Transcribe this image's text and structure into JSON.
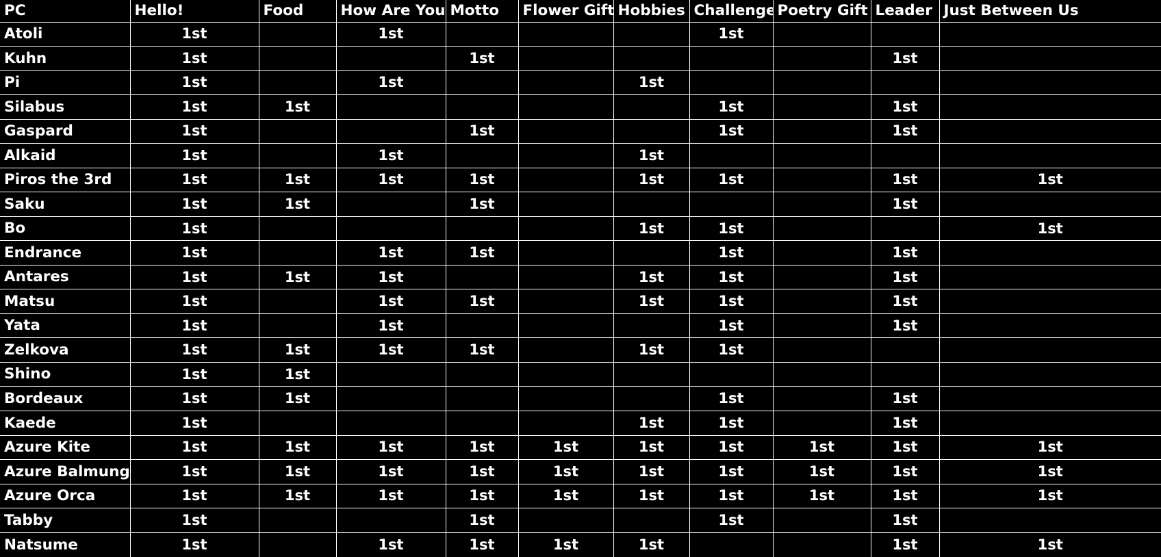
{
  "table": {
    "mark": "1st",
    "empty": "",
    "columns": [
      "PC",
      "Hello!",
      "Food",
      "How Are You?",
      "Motto",
      "Flower Gift",
      "Hobbies",
      "Challenge",
      "Poetry Gift",
      "Leader",
      "Just Between Us"
    ],
    "rows": [
      {
        "pc": "Atoli",
        "marks": [
          "1st",
          "",
          "1st",
          "",
          "",
          "",
          "1st",
          "",
          "",
          ""
        ]
      },
      {
        "pc": "Kuhn",
        "marks": [
          "1st",
          "",
          "",
          "1st",
          "",
          "",
          "",
          "",
          "1st",
          ""
        ]
      },
      {
        "pc": "Pi",
        "marks": [
          "1st",
          "",
          "1st",
          "",
          "",
          "1st",
          "",
          "",
          "",
          ""
        ]
      },
      {
        "pc": "Silabus",
        "marks": [
          "1st",
          "1st",
          "",
          "",
          "",
          "",
          "1st",
          "",
          "1st",
          ""
        ]
      },
      {
        "pc": "Gaspard",
        "marks": [
          "1st",
          "",
          "",
          "1st",
          "",
          "",
          "1st",
          "",
          "1st",
          ""
        ]
      },
      {
        "pc": "Alkaid",
        "marks": [
          "1st",
          "",
          "1st",
          "",
          "",
          "1st",
          "",
          "",
          "",
          ""
        ]
      },
      {
        "pc": "Piros the 3rd",
        "marks": [
          "1st",
          "1st",
          "1st",
          "1st",
          "",
          "1st",
          "1st",
          "",
          "1st",
          "1st"
        ]
      },
      {
        "pc": "Saku",
        "marks": [
          "1st",
          "1st",
          "",
          "1st",
          "",
          "",
          "",
          "",
          "1st",
          ""
        ]
      },
      {
        "pc": "Bo",
        "marks": [
          "1st",
          "",
          "",
          "",
          "",
          "1st",
          "1st",
          "",
          "",
          "1st"
        ]
      },
      {
        "pc": "Endrance",
        "marks": [
          "1st",
          "",
          "1st",
          "1st",
          "",
          "",
          "1st",
          "",
          "1st",
          ""
        ]
      },
      {
        "pc": "Antares",
        "marks": [
          "1st",
          "1st",
          "1st",
          "",
          "",
          "1st",
          "1st",
          "",
          "1st",
          ""
        ]
      },
      {
        "pc": "Matsu",
        "marks": [
          "1st",
          "",
          "1st",
          "1st",
          "",
          "1st",
          "1st",
          "",
          "1st",
          ""
        ]
      },
      {
        "pc": "Yata",
        "marks": [
          "1st",
          "",
          "1st",
          "",
          "",
          "",
          "1st",
          "",
          "1st",
          ""
        ]
      },
      {
        "pc": "Zelkova",
        "marks": [
          "1st",
          "1st",
          "1st",
          "1st",
          "",
          "1st",
          "1st",
          "",
          "",
          ""
        ]
      },
      {
        "pc": "Shino",
        "marks": [
          "1st",
          "1st",
          "",
          "",
          "",
          "",
          "",
          "",
          "",
          ""
        ]
      },
      {
        "pc": "Bordeaux",
        "marks": [
          "1st",
          "1st",
          "",
          "",
          "",
          "",
          "1st",
          "",
          "1st",
          ""
        ]
      },
      {
        "pc": "Kaede",
        "marks": [
          "1st",
          "",
          "",
          "",
          "",
          "1st",
          "1st",
          "",
          "1st",
          ""
        ]
      },
      {
        "pc": "Azure Kite",
        "marks": [
          "1st",
          "1st",
          "1st",
          "1st",
          "1st",
          "1st",
          "1st",
          "1st",
          "1st",
          "1st"
        ]
      },
      {
        "pc": "Azure Balmung",
        "marks": [
          "1st",
          "1st",
          "1st",
          "1st",
          "1st",
          "1st",
          "1st",
          "1st",
          "1st",
          "1st"
        ]
      },
      {
        "pc": "Azure Orca",
        "marks": [
          "1st",
          "1st",
          "1st",
          "1st",
          "1st",
          "1st",
          "1st",
          "1st",
          "1st",
          "1st"
        ]
      },
      {
        "pc": "Tabby",
        "marks": [
          "1st",
          "",
          "",
          "1st",
          "",
          "",
          "1st",
          "",
          "1st",
          ""
        ]
      },
      {
        "pc": "Natsume",
        "marks": [
          "1st",
          "",
          "1st",
          "1st",
          "1st",
          "1st",
          "",
          "",
          "1st",
          "1st"
        ]
      }
    ]
  }
}
